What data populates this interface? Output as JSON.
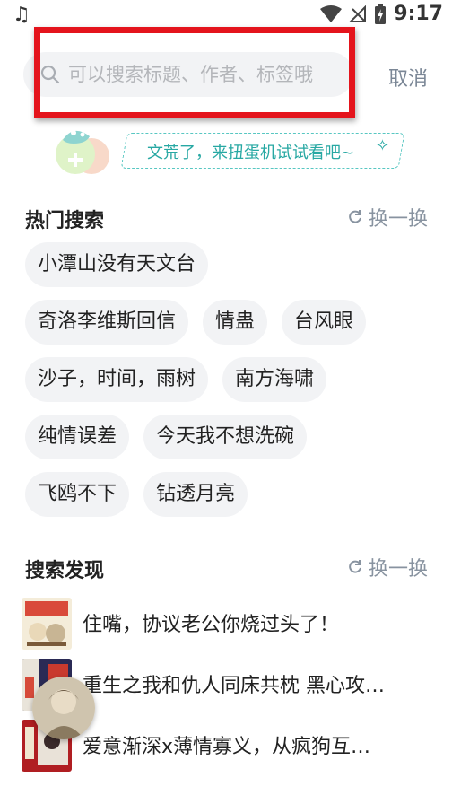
{
  "status_bar": {
    "time": "9:17",
    "music_icon": "music-note-icon",
    "wifi_icon": "wifi-icon",
    "signal_icon": "no-signal-icon",
    "battery_icon": "battery-charging-icon"
  },
  "search": {
    "placeholder": "可以搜索标题、作者、标签哦",
    "value": "",
    "cancel_label": "取消",
    "highlight_color": "#e4141c"
  },
  "banner": {
    "text": "文荒了，来扭蛋机试试看吧~"
  },
  "hot_search": {
    "title": "热门搜索",
    "refresh_label": "换一换",
    "rows": [
      [
        "小潭山没有天文台"
      ],
      [
        "奇洛李维斯回信",
        "情蛊",
        "台风眼"
      ],
      [
        "沙子，时间，雨树",
        "南方海啸"
      ],
      [
        "纯情误差",
        "今天我不想洗碗"
      ],
      [
        "飞鸥不下",
        "钻透月亮"
      ]
    ]
  },
  "discover": {
    "title": "搜索发现",
    "refresh_label": "换一换",
    "items": [
      {
        "title": "住嘴，协议老公你烧过头了！"
      },
      {
        "title": "重生之我和仇人同床共枕 黑心攻…"
      },
      {
        "title": "爱意渐深x薄情寡义，从疯狗互…"
      }
    ]
  },
  "colors": {
    "accent_teal": "#27a8a3",
    "muted_gray": "#8893a0",
    "tag_bg": "#f2f3f5"
  }
}
